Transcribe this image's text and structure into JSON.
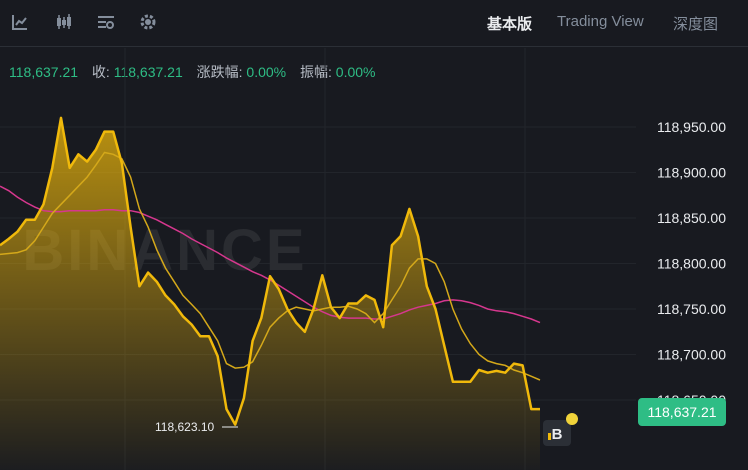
{
  "toolbar": {
    "icons": [
      "line-chart-icon",
      "candlestick-icon",
      "indicators-icon",
      "settings-gear-icon"
    ],
    "tabs": [
      {
        "label": "基本版",
        "active": true
      },
      {
        "label": "Trading View",
        "active": false
      },
      {
        "label": "深度图",
        "active": false
      }
    ]
  },
  "info": {
    "price": "118,637.21",
    "close_label": "收:",
    "close_value": "118,637.21",
    "change_label": "涨跌幅:",
    "change_value": "0.00%",
    "amplitude_label": "振幅:",
    "amplitude_value": "0.00%"
  },
  "watermark": "BINANCE",
  "current_price_label": "118,637.21",
  "low_label": "118,623.10",
  "colors": {
    "background": "#181a20",
    "price_line": "#f0b90b",
    "ma_fast": "#d4a81a",
    "ma_slow": "#d6378e",
    "up": "#2ebd85"
  },
  "chart_data": {
    "type": "area",
    "yticks": [
      118950,
      118900,
      118850,
      118800,
      118750,
      118700,
      118650
    ],
    "ytick_labels": [
      "118,950.00",
      "118,900.00",
      "118,850.00",
      "118,800.00",
      "118,750.00",
      "118,700.00",
      "118,650.00"
    ],
    "ylim": [
      118600,
      118990
    ],
    "series": [
      {
        "name": "",
        "role": "price",
        "values": [
          118820,
          118827,
          118835,
          118848,
          118848,
          118865,
          118905,
          118960,
          118905,
          118920,
          118912,
          118925,
          118945,
          118945,
          118910,
          118840,
          118775,
          118790,
          118780,
          118765,
          118755,
          118742,
          118733,
          118720,
          118720,
          118698,
          118640,
          118623,
          118652,
          118715,
          118740,
          118786,
          118772,
          118750,
          118735,
          118725,
          118750,
          118787,
          118752,
          118740,
          118756,
          118756,
          118765,
          118760,
          118730,
          118820,
          118830,
          118860,
          118830,
          118775,
          118750,
          118710,
          118670,
          118670,
          118670,
          118683,
          118680,
          118682,
          118680,
          118690,
          118688,
          118640,
          118640
        ]
      },
      {
        "name": "",
        "role": "ma_fast",
        "values": [
          118810,
          118811,
          118812,
          118815,
          118825,
          118840,
          118855,
          118865,
          118875,
          118885,
          118895,
          118908,
          118922,
          118920,
          118915,
          118895,
          118860,
          118840,
          118815,
          118795,
          118780,
          118765,
          118755,
          118745,
          118730,
          118715,
          118690,
          118685,
          118686,
          118692,
          118710,
          118730,
          118740,
          118748,
          118752,
          118750,
          118748,
          118750,
          118752,
          118752,
          118753,
          118750,
          118745,
          118735,
          118745,
          118760,
          118775,
          118795,
          118805,
          118805,
          118800,
          118780,
          118750,
          118728,
          118712,
          118700,
          118693,
          118690,
          118688,
          118683,
          118680,
          118676,
          118672
        ]
      },
      {
        "name": "",
        "role": "ma_slow",
        "values": [
          118885,
          118880,
          118873,
          118867,
          118862,
          118858,
          118857,
          118857,
          118858,
          118858,
          118858,
          118858,
          118859,
          118859,
          118858,
          118858,
          118856,
          118852,
          118848,
          118843,
          118838,
          118833,
          118827,
          118822,
          118817,
          118812,
          118806,
          118801,
          118796,
          118791,
          118787,
          118782,
          118776,
          118770,
          118764,
          118758,
          118752,
          118747,
          118743,
          118741,
          118740,
          118740,
          118740,
          118739,
          118739,
          118742,
          118745,
          118749,
          118752,
          118754,
          118756,
          118759,
          118760,
          118759,
          118757,
          118754,
          118750,
          118748,
          118747,
          118745,
          118742,
          118739,
          118735
        ]
      }
    ]
  }
}
